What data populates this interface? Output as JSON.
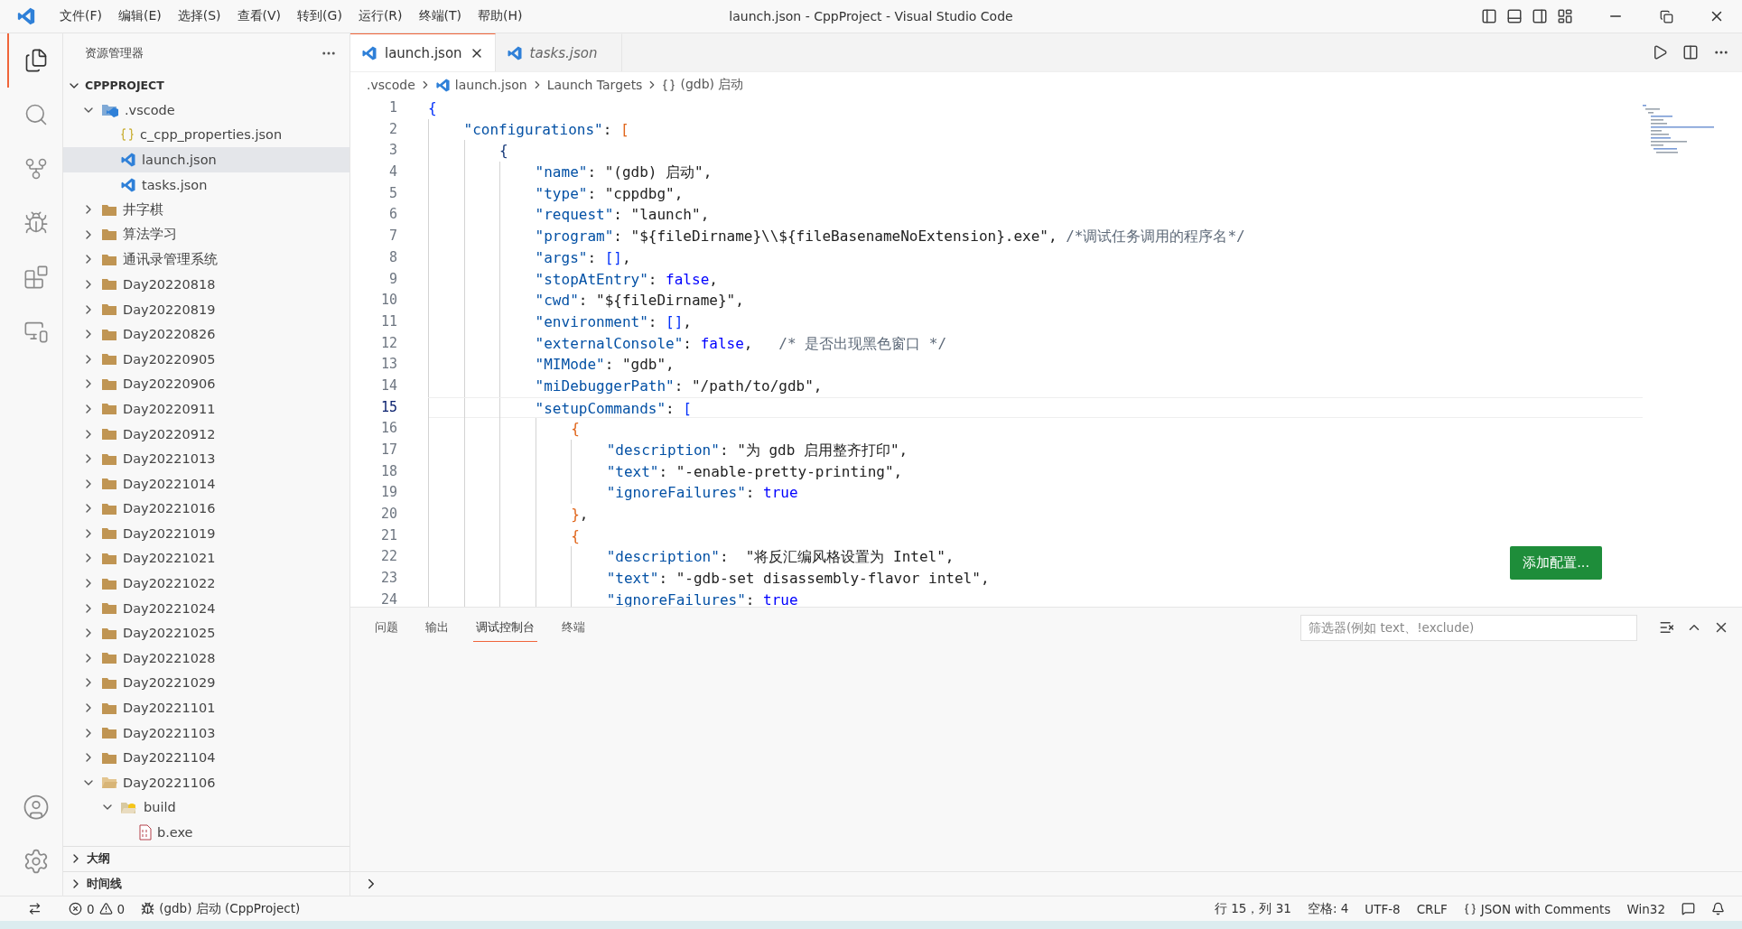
{
  "title_bar": {
    "menu": [
      "文件(F)",
      "编辑(E)",
      "选择(S)",
      "查看(V)",
      "转到(G)",
      "运行(R)",
      "终端(T)",
      "帮助(H)"
    ],
    "title": "launch.json - CppProject - Visual Studio Code"
  },
  "activity_bar": {
    "items": [
      {
        "kind": "explorer",
        "selected": true
      },
      {
        "kind": "search",
        "selected": false
      },
      {
        "kind": "source-control",
        "selected": false
      },
      {
        "kind": "run-debug",
        "selected": false
      },
      {
        "kind": "extensions",
        "selected": false
      },
      {
        "kind": "remote",
        "selected": false
      }
    ],
    "bottom_items": [
      {
        "kind": "account"
      },
      {
        "kind": "settings"
      }
    ]
  },
  "sidebar": {
    "title": "资源管理器",
    "project": {
      "label": "CPPPROJECT",
      "expanded": true
    },
    "tree": [
      {
        "label": ".vscode",
        "kind": "vscode-folder",
        "expanded": true,
        "selected": false,
        "children": [
          {
            "label": "c_cpp_properties.json",
            "kind": "json-file",
            "selected": false
          },
          {
            "label": "launch.json",
            "kind": "vscode-file",
            "selected": true
          },
          {
            "label": "tasks.json",
            "kind": "vscode-file",
            "selected": false
          }
        ]
      },
      {
        "label": "井字棋",
        "kind": "folder",
        "expanded": false,
        "selected": false
      },
      {
        "label": "算法学习",
        "kind": "folder",
        "expanded": false,
        "selected": false
      },
      {
        "label": "通讯录管理系统",
        "kind": "folder",
        "expanded": false,
        "selected": false
      },
      {
        "label": "Day20220818",
        "kind": "folder",
        "expanded": false,
        "selected": false
      },
      {
        "label": "Day20220819",
        "kind": "folder",
        "expanded": false,
        "selected": false
      },
      {
        "label": "Day20220826",
        "kind": "folder",
        "expanded": false,
        "selected": false
      },
      {
        "label": "Day20220905",
        "kind": "folder",
        "expanded": false,
        "selected": false
      },
      {
        "label": "Day20220906",
        "kind": "folder",
        "expanded": false,
        "selected": false
      },
      {
        "label": "Day20220911",
        "kind": "folder",
        "expanded": false,
        "selected": false
      },
      {
        "label": "Day20220912",
        "kind": "folder",
        "expanded": false,
        "selected": false
      },
      {
        "label": "Day20221013",
        "kind": "folder",
        "expanded": false,
        "selected": false
      },
      {
        "label": "Day20221014",
        "kind": "folder",
        "expanded": false,
        "selected": false
      },
      {
        "label": "Day20221016",
        "kind": "folder",
        "expanded": false,
        "selected": false
      },
      {
        "label": "Day20221019",
        "kind": "folder",
        "expanded": false,
        "selected": false
      },
      {
        "label": "Day20221021",
        "kind": "folder",
        "expanded": false,
        "selected": false
      },
      {
        "label": "Day20221022",
        "kind": "folder",
        "expanded": false,
        "selected": false
      },
      {
        "label": "Day20221024",
        "kind": "folder",
        "expanded": false,
        "selected": false
      },
      {
        "label": "Day20221025",
        "kind": "folder",
        "expanded": false,
        "selected": false
      },
      {
        "label": "Day20221028",
        "kind": "folder",
        "expanded": false,
        "selected": false
      },
      {
        "label": "Day20221029",
        "kind": "folder",
        "expanded": false,
        "selected": false
      },
      {
        "label": "Day20221101",
        "kind": "folder",
        "expanded": false,
        "selected": false
      },
      {
        "label": "Day20221103",
        "kind": "folder",
        "expanded": false,
        "selected": false
      },
      {
        "label": "Day20221104",
        "kind": "folder",
        "expanded": false,
        "selected": false
      },
      {
        "label": "Day20221106",
        "kind": "folder",
        "expanded": true,
        "selected": false,
        "children": [
          {
            "label": "build",
            "kind": "build-folder",
            "expanded": true,
            "selected": false,
            "children": [
              {
                "label": "b.exe",
                "kind": "exe-file",
                "selected": false
              }
            ]
          }
        ]
      }
    ],
    "sections": [
      {
        "label": "大纲",
        "expanded": false
      },
      {
        "label": "时间线",
        "expanded": false
      }
    ]
  },
  "tabs": [
    {
      "label": "launch.json",
      "selected": true,
      "preview": false
    },
    {
      "label": "tasks.json",
      "selected": false,
      "preview": true
    }
  ],
  "breadcrumb": [
    {
      "label": ".vscode",
      "kind": "folder"
    },
    {
      "label": "launch.json",
      "kind": "file"
    },
    {
      "label": "Launch Targets",
      "kind": "item"
    },
    {
      "label": "(gdb) 启动",
      "kind": "object"
    }
  ],
  "editor": {
    "lines": [
      {
        "number": "1",
        "current": false,
        "tokens": [
          {
            "kind": "bracket",
            "text": "{",
            "color": "#0431fa"
          }
        ]
      },
      {
        "number": "2",
        "current": false,
        "tokens": [
          {
            "kind": "key",
            "text": "    \"configurations\""
          },
          {
            "kind": "punct",
            "text": ": "
          },
          {
            "kind": "bracket",
            "text": "[",
            "color": "#e0661c"
          }
        ]
      },
      {
        "number": "3",
        "current": false,
        "tokens": [
          {
            "kind": "bracket",
            "text": "        {",
            "color": "#1a3d7c"
          }
        ]
      },
      {
        "number": "4",
        "current": false,
        "tokens": [
          {
            "kind": "key",
            "text": "            \"name\""
          },
          {
            "kind": "punct",
            "text": ": "
          },
          {
            "kind": "str",
            "text": "\"(gdb) 启动\""
          },
          {
            "kind": "punct",
            "text": ","
          }
        ]
      },
      {
        "number": "5",
        "current": false,
        "tokens": [
          {
            "kind": "key",
            "text": "            \"type\""
          },
          {
            "kind": "punct",
            "text": ": "
          },
          {
            "kind": "str",
            "text": "\"cppdbg\""
          },
          {
            "kind": "punct",
            "text": ","
          }
        ]
      },
      {
        "number": "6",
        "current": false,
        "tokens": [
          {
            "kind": "key",
            "text": "            \"request\""
          },
          {
            "kind": "punct",
            "text": ": "
          },
          {
            "kind": "str",
            "text": "\"launch\""
          },
          {
            "kind": "punct",
            "text": ","
          }
        ]
      },
      {
        "number": "7",
        "current": false,
        "tokens": [
          {
            "kind": "key",
            "text": "            \"program\""
          },
          {
            "kind": "punct",
            "text": ": "
          },
          {
            "kind": "str",
            "text": "\"${fileDirname}\\\\${fileBasenameNoExtension}.exe\""
          },
          {
            "kind": "punct",
            "text": ", "
          },
          {
            "kind": "comment",
            "text": "/*调试任务调用的程序名*/"
          }
        ]
      },
      {
        "number": "8",
        "current": false,
        "tokens": [
          {
            "kind": "key",
            "text": "            \"args\""
          },
          {
            "kind": "punct",
            "text": ": "
          },
          {
            "kind": "bracket",
            "text": "[]",
            "color": "#0431fa"
          },
          {
            "kind": "punct",
            "text": ","
          }
        ]
      },
      {
        "number": "9",
        "current": false,
        "tokens": [
          {
            "kind": "key",
            "text": "            \"stopAtEntry\""
          },
          {
            "kind": "punct",
            "text": ": "
          },
          {
            "kind": "bool",
            "text": "false"
          },
          {
            "kind": "punct",
            "text": ","
          }
        ]
      },
      {
        "number": "10",
        "current": false,
        "tokens": [
          {
            "kind": "key",
            "text": "            \"cwd\""
          },
          {
            "kind": "punct",
            "text": ": "
          },
          {
            "kind": "str",
            "text": "\"${fileDirname}\""
          },
          {
            "kind": "punct",
            "text": ","
          }
        ]
      },
      {
        "number": "11",
        "current": false,
        "tokens": [
          {
            "kind": "key",
            "text": "            \"environment\""
          },
          {
            "kind": "punct",
            "text": ": "
          },
          {
            "kind": "bracket",
            "text": "[]",
            "color": "#0431fa"
          },
          {
            "kind": "punct",
            "text": ","
          }
        ]
      },
      {
        "number": "12",
        "current": false,
        "tokens": [
          {
            "kind": "key",
            "text": "            \"externalConsole\""
          },
          {
            "kind": "punct",
            "text": ": "
          },
          {
            "kind": "bool",
            "text": "false"
          },
          {
            "kind": "punct",
            "text": ",   "
          },
          {
            "kind": "comment",
            "text": "/* 是否出现黑色窗口 */"
          }
        ]
      },
      {
        "number": "13",
        "current": false,
        "tokens": [
          {
            "kind": "key",
            "text": "            \"MIMode\""
          },
          {
            "kind": "punct",
            "text": ": "
          },
          {
            "kind": "str",
            "text": "\"gdb\""
          },
          {
            "kind": "punct",
            "text": ","
          }
        ]
      },
      {
        "number": "14",
        "current": false,
        "tokens": [
          {
            "kind": "key",
            "text": "            \"miDebuggerPath\""
          },
          {
            "kind": "punct",
            "text": ": "
          },
          {
            "kind": "str",
            "text": "\"/path/to/gdb\""
          },
          {
            "kind": "punct",
            "text": ","
          }
        ]
      },
      {
        "number": "15",
        "current": true,
        "tokens": [
          {
            "kind": "key",
            "text": "            \"setupCommands\""
          },
          {
            "kind": "punct",
            "text": ": "
          },
          {
            "kind": "bracket",
            "text": "[",
            "color": "#0431fa"
          }
        ]
      },
      {
        "number": "16",
        "current": false,
        "tokens": [
          {
            "kind": "bracket",
            "text": "                {",
            "color": "#e0661c"
          }
        ]
      },
      {
        "number": "17",
        "current": false,
        "tokens": [
          {
            "kind": "key",
            "text": "                    \"description\""
          },
          {
            "kind": "punct",
            "text": ": "
          },
          {
            "kind": "str",
            "text": "\"为 gdb 启用整齐打印\""
          },
          {
            "kind": "punct",
            "text": ","
          }
        ]
      },
      {
        "number": "18",
        "current": false,
        "tokens": [
          {
            "kind": "key",
            "text": "                    \"text\""
          },
          {
            "kind": "punct",
            "text": ": "
          },
          {
            "kind": "str",
            "text": "\"-enable-pretty-printing\""
          },
          {
            "kind": "punct",
            "text": ","
          }
        ]
      },
      {
        "number": "19",
        "current": false,
        "tokens": [
          {
            "kind": "key",
            "text": "                    \"ignoreFailures\""
          },
          {
            "kind": "punct",
            "text": ": "
          },
          {
            "kind": "bool",
            "text": "true"
          }
        ]
      },
      {
        "number": "20",
        "current": false,
        "tokens": [
          {
            "kind": "bracket",
            "text": "                }",
            "color": "#e0661c"
          },
          {
            "kind": "punct",
            "text": ","
          }
        ]
      },
      {
        "number": "21",
        "current": false,
        "tokens": [
          {
            "kind": "bracket",
            "text": "                {",
            "color": "#e0661c"
          }
        ]
      },
      {
        "number": "22",
        "current": false,
        "tokens": [
          {
            "kind": "key",
            "text": "                    \"description\""
          },
          {
            "kind": "punct",
            "text": ":  "
          },
          {
            "kind": "str",
            "text": "\"将反汇编风格设置为 Intel\""
          },
          {
            "kind": "punct",
            "text": ","
          }
        ]
      },
      {
        "number": "23",
        "current": false,
        "tokens": [
          {
            "kind": "key",
            "text": "                    \"text\""
          },
          {
            "kind": "punct",
            "text": ": "
          },
          {
            "kind": "str",
            "text": "\"-gdb-set disassembly-flavor intel\""
          },
          {
            "kind": "punct",
            "text": ","
          }
        ]
      },
      {
        "number": "24",
        "current": false,
        "tokens": [
          {
            "kind": "key",
            "text": "                    \"ignoreFailures\""
          },
          {
            "kind": "punct",
            "text": ": "
          },
          {
            "kind": "bool",
            "text": "true"
          }
        ]
      }
    ],
    "add_config_button": "添加配置..."
  },
  "panel": {
    "tabs": [
      {
        "label": "问题",
        "selected": false
      },
      {
        "label": "输出",
        "selected": false
      },
      {
        "label": "调试控制台",
        "selected": true
      },
      {
        "label": "终端",
        "selected": false
      }
    ],
    "filter": {
      "placeholder": "筛选器(例如 text、!exclude)"
    }
  },
  "status_bar": {
    "errors": "0",
    "warnings": "0",
    "debug_target": "(gdb) 启动 (CppProject)",
    "items": [
      {
        "kind": "text",
        "label": "行 15，列 31"
      },
      {
        "kind": "text",
        "label": "空格: 4"
      },
      {
        "kind": "text",
        "label": "UTF-8"
      },
      {
        "kind": "text",
        "label": "CRLF"
      },
      {
        "kind": "language",
        "label": "JSON with Comments"
      },
      {
        "kind": "text",
        "label": "Win32"
      }
    ]
  }
}
